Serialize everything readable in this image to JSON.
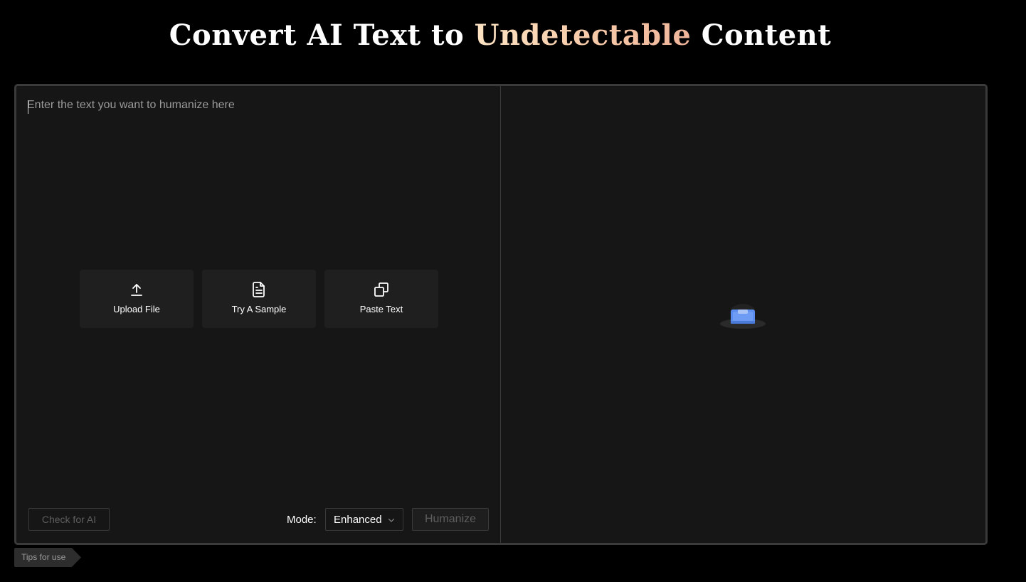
{
  "header": {
    "title_part1": "Convert AI Text to",
    "title_accent": "Undetectable",
    "title_part2": "Content"
  },
  "editor": {
    "placeholder": "Enter the text you want to humanize here"
  },
  "actions": [
    {
      "label": "Upload File",
      "icon": "upload-icon"
    },
    {
      "label": "Try A Sample",
      "icon": "document-icon"
    },
    {
      "label": "Paste Text",
      "icon": "copy-icon"
    }
  ],
  "toolbar": {
    "check_label": "Check for AI",
    "mode_label": "Mode:",
    "mode_value": "Enhanced",
    "humanize_label": "Humanize"
  },
  "output": {
    "empty_icon": "empty-inbox-icon"
  },
  "footer": {
    "tips_label": "Tips for use"
  },
  "colors": {
    "background": "#000000",
    "panel": "#161616",
    "border": "#3a3a3a",
    "accent_start": "#fde3c2",
    "accent_end": "#f0b59b",
    "illustration_blue": "#5b8def"
  }
}
